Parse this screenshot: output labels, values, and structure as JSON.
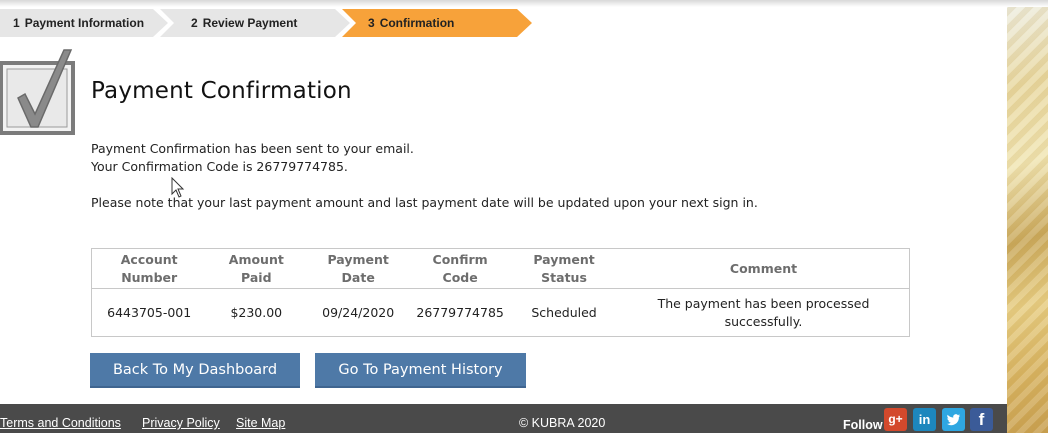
{
  "stepper": {
    "steps": [
      {
        "num": "1",
        "label": "Payment Information"
      },
      {
        "num": "2",
        "label": "Review Payment"
      },
      {
        "num": "3",
        "label": "Confirmation"
      }
    ],
    "active_color": "#f7a23a",
    "inactive_color": "#e6e6e6"
  },
  "main": {
    "title": "Payment Confirmation",
    "email_message": "Payment Confirmation has been sent to your email.",
    "code_message": "Your Confirmation Code is 26779774785.",
    "note": "Please note that your last payment amount and last payment date will be updated upon your next sign in."
  },
  "table": {
    "headers": {
      "account": [
        "Account",
        "Number"
      ],
      "amount": [
        "Amount",
        "Paid"
      ],
      "date": [
        "Payment",
        "Date"
      ],
      "code": [
        "Confirm",
        "Code"
      ],
      "status": [
        "Payment",
        "Status"
      ],
      "comment": "Comment"
    },
    "row": {
      "account": "6443705-001",
      "amount": "$230.00",
      "date": "09/24/2020",
      "code": "26779774785",
      "status": "Scheduled",
      "comment": [
        "The payment has been processed",
        "successfully."
      ]
    }
  },
  "buttons": {
    "dashboard": "Back To My Dashboard",
    "history": "Go To Payment History",
    "color": "#4e79a7"
  },
  "footer": {
    "terms": "Terms and Conditions",
    "privacy": "Privacy Policy",
    "sitemap": "Site Map",
    "copyright": "© KUBRA 2020",
    "follow": "Follow",
    "social": {
      "gplus": "g+",
      "linkedin": "in",
      "facebook": "f"
    }
  }
}
